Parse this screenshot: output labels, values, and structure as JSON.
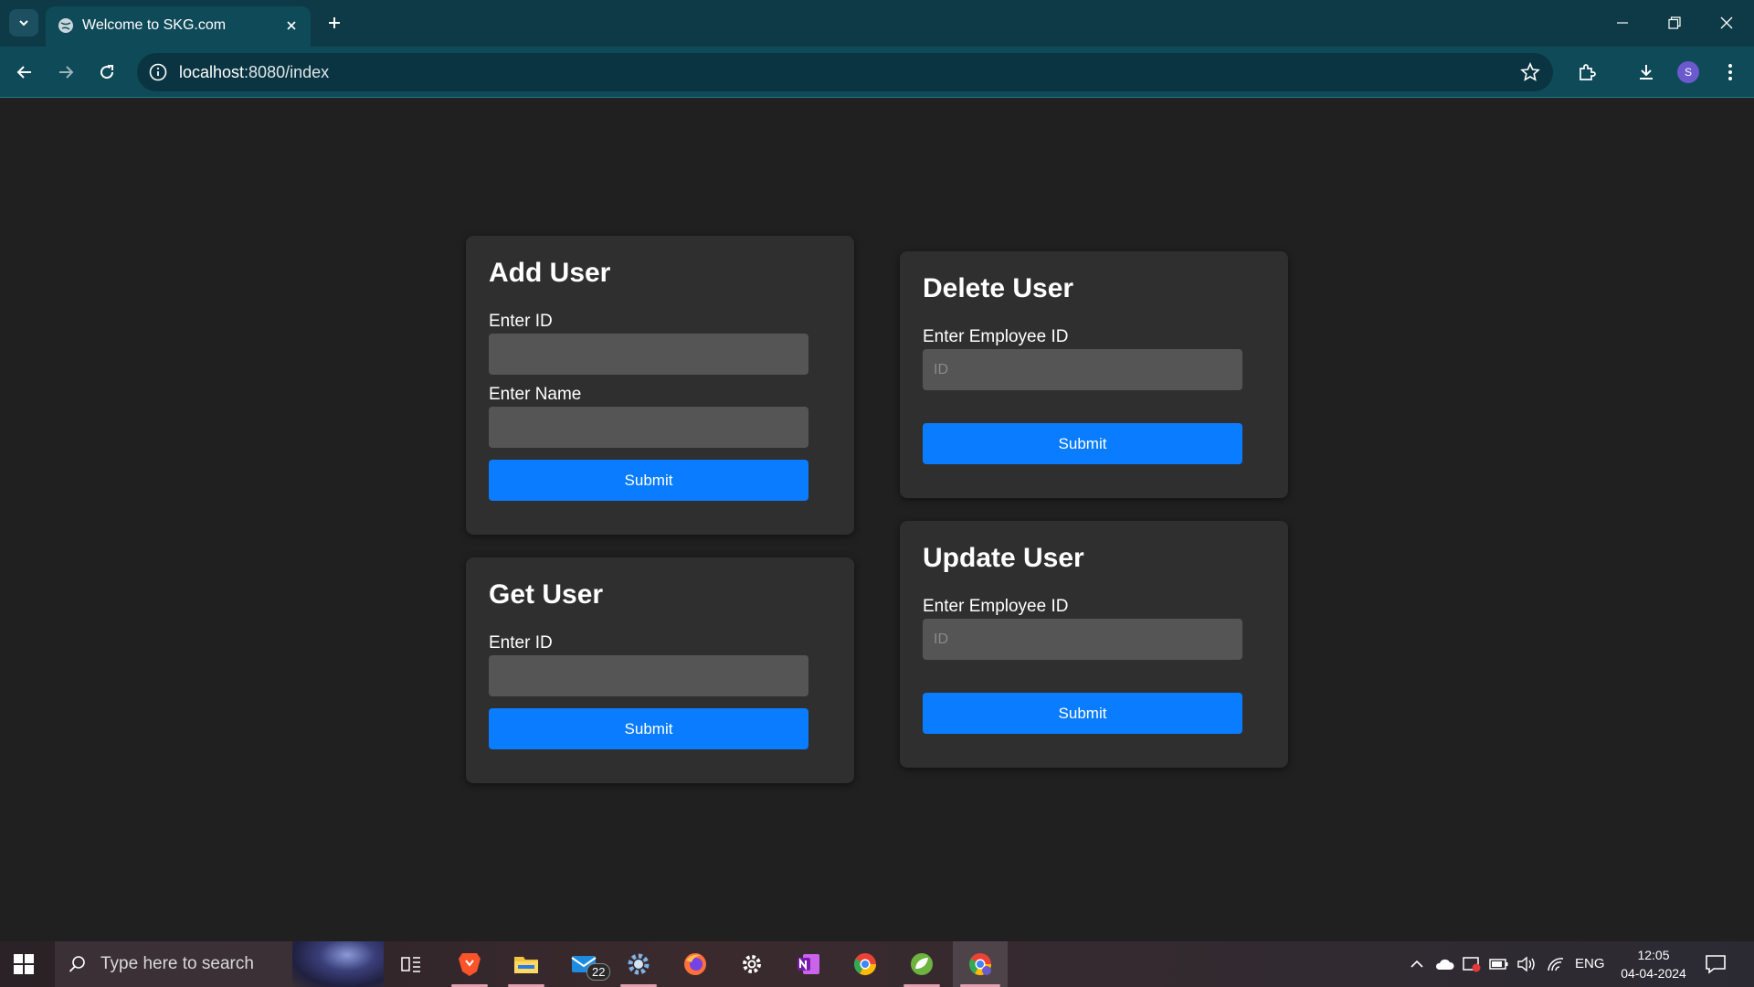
{
  "browser": {
    "tab_title": "Welcome to SKG.com",
    "url_host": "localhost",
    "url_rest": ":8080/index",
    "profile_initial": "S"
  },
  "cards": {
    "add": {
      "title": "Add User",
      "id_label": "Enter ID",
      "id_value": "",
      "name_label": "Enter Name",
      "name_value": "",
      "submit": "Submit"
    },
    "get": {
      "title": "Get User",
      "id_label": "Enter ID",
      "id_value": "",
      "submit": "Submit"
    },
    "delete": {
      "title": "Delete User",
      "id_label": "Enter Employee ID",
      "id_placeholder": "ID",
      "submit": "Submit"
    },
    "update": {
      "title": "Update User",
      "id_label": "Enter Employee ID",
      "id_placeholder": "ID",
      "submit": "Submit"
    }
  },
  "taskbar": {
    "search_placeholder": "Type here to search",
    "mail_badge": "22",
    "lang": "ENG",
    "time": "12:05",
    "date": "04-04-2024",
    "apps": [
      "brave-icon",
      "file-explorer-icon",
      "mail-icon",
      "settings-gear-icon",
      "firefox-icon",
      "settings-icon",
      "onenote-icon",
      "chrome-icon",
      "spring-icon",
      "chrome-profile-icon"
    ]
  },
  "colors": {
    "accent_button": "#0a7cff",
    "card_bg": "#2f2f2f",
    "page_bg": "#202020",
    "chrome_bg": "#0f4a59"
  }
}
